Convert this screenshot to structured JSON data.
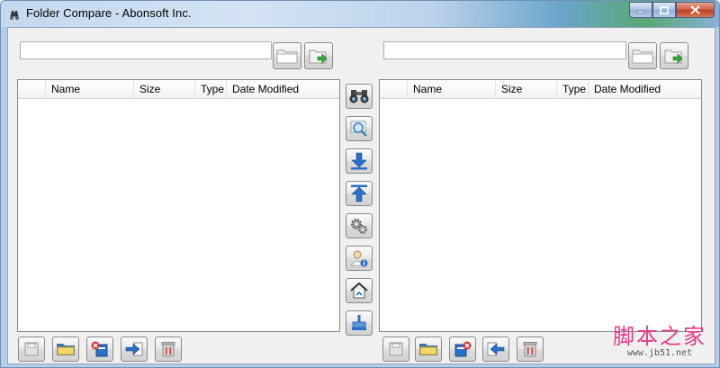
{
  "window": {
    "title": "Folder Compare - Abonsoft Inc."
  },
  "left": {
    "path_value": "",
    "columns": [
      "Name",
      "Size",
      "Type",
      "Date Modified"
    ]
  },
  "right": {
    "path_value": "",
    "columns": [
      "Name",
      "Size",
      "Type",
      "Date Modified"
    ]
  },
  "icons": {
    "browse": "folder-icon",
    "go": "folder-go-icon",
    "compare": "binoculars-icon",
    "zoom": "magnifier-icon",
    "download": "arrow-down-icon",
    "upload": "arrow-up-icon",
    "settings": "gears-icon",
    "about": "user-info-icon",
    "home": "home-icon",
    "clean": "broom-icon",
    "save": "save-icon",
    "new_folder": "new-folder-icon",
    "delete": "delete-file-icon",
    "copy_right": "copy-right-icon",
    "copy_left": "copy-left-icon",
    "trash": "trash-icon"
  },
  "watermark": {
    "text": "脚本之家",
    "url": "www.jb51.net"
  },
  "colors": {
    "accent": "#2a6fc9",
    "window_frame": "#b7cde7",
    "close_red": "#c03a1e"
  }
}
